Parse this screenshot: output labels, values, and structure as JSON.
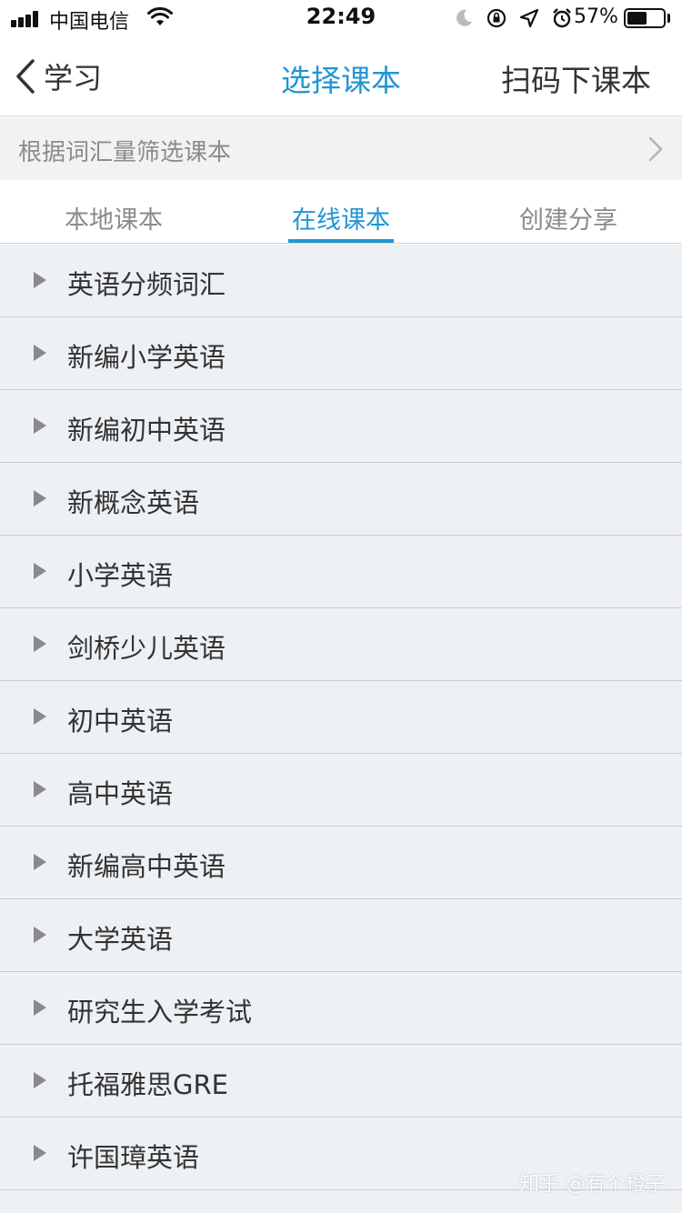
{
  "status_bar": {
    "carrier": "中国电信",
    "time": "22:49",
    "battery_percent": "57%",
    "battery_level": 0.57,
    "icons": [
      "signal-icon",
      "wifi-icon",
      "moon-icon",
      "rotation-lock-icon",
      "location-icon",
      "alarm-icon",
      "battery-icon"
    ]
  },
  "nav": {
    "back_label": "学习",
    "title": "选择课本",
    "right_label": "扫码下课本",
    "title_color": "#2196d3"
  },
  "filter": {
    "label": "根据词汇量筛选课本"
  },
  "tabs": [
    {
      "label": "本地课本",
      "active": false
    },
    {
      "label": "在线课本",
      "active": true
    },
    {
      "label": "创建分享",
      "active": false
    }
  ],
  "list": {
    "items": [
      "英语分频词汇",
      "新编小学英语",
      "新编初中英语",
      "新概念英语",
      "小学英语",
      "剑桥少儿英语",
      "初中英语",
      "高中英语",
      "新编高中英语",
      "大学英语",
      "研究生入学考试",
      "托福雅思GRE",
      "许国璋英语"
    ]
  },
  "watermark": "知乎 @有个橙子"
}
